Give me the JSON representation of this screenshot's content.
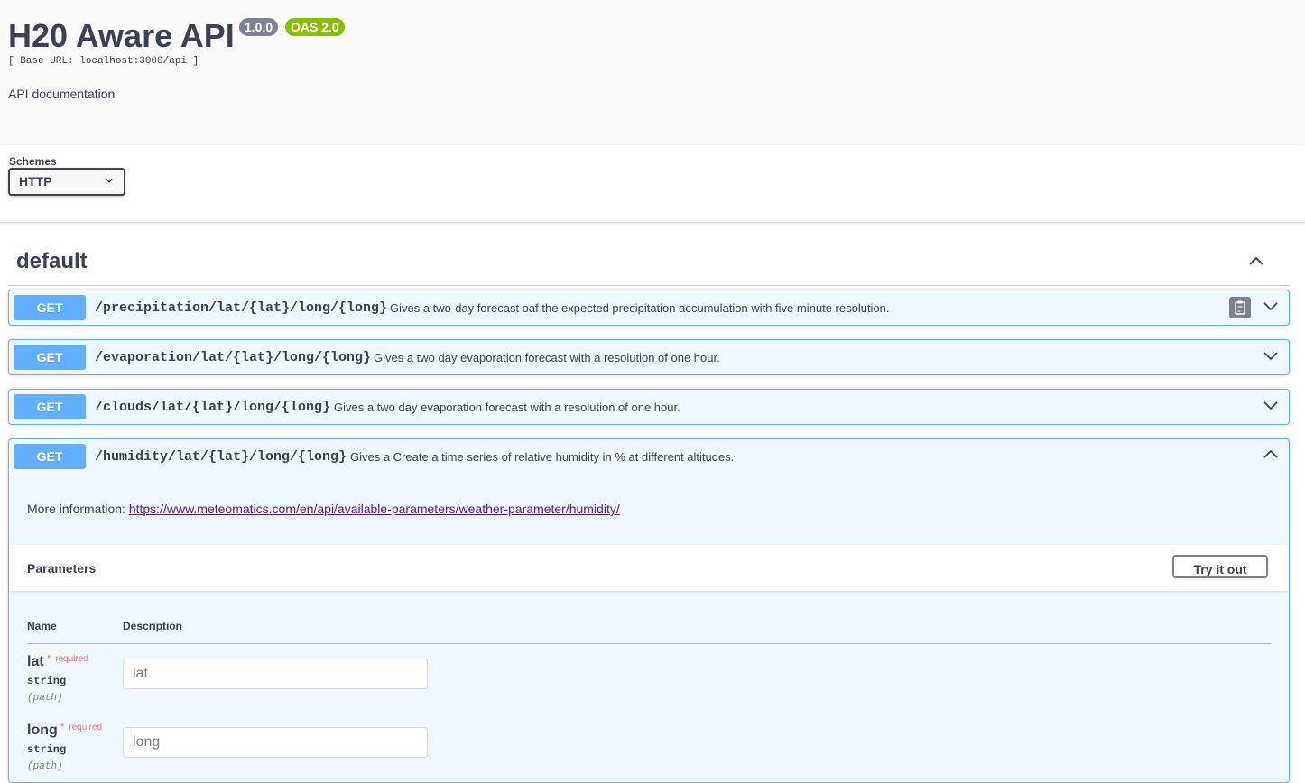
{
  "info": {
    "title": "H20 Aware API",
    "version": "1.0.0",
    "oas": "OAS 2.0",
    "base_url": "[ Base URL: localhost:3000/api ]",
    "description": "API documentation"
  },
  "schemes": {
    "label": "Schemes",
    "selected": "HTTP"
  },
  "section": {
    "title": "default",
    "icon": "chevron-up-icon"
  },
  "operations": [
    {
      "method": "GET",
      "path": "/precipitation/lat/{lat}/long/{long}",
      "description": "Gives a two-day forecast oaf the expected precipitation accumulation with five minute resolution.",
      "expanded": false
    },
    {
      "method": "GET",
      "path": "/evaporation/lat/{lat}/long/{long}",
      "description": "Gives a two day evaporation forecast with a resolution of one hour.",
      "expanded": false
    },
    {
      "method": "GET",
      "path": "/clouds/lat/{lat}/long/{long}",
      "description": "Gives a two day evaporation forecast with a resolution of one hour.",
      "expanded": false
    },
    {
      "method": "GET",
      "path": "/humidity/lat/{lat}/long/{long}",
      "description": "Gives a Create a time series of relative humidity in % at different altitudes.",
      "expanded": true,
      "more_info_label": "More information:",
      "more_info_link": "https://www.meteomatics.com/en/api/available-parameters/weather-parameter/humidity/",
      "parameters_title": "Parameters",
      "try_it_out": "Try it out",
      "table_headers": {
        "name": "Name",
        "description": "Description"
      },
      "params": [
        {
          "name": "lat",
          "required_star": "*",
          "required": "required",
          "type": "string",
          "in": "(path)",
          "placeholder": "lat"
        },
        {
          "name": "long",
          "required_star": "*",
          "required": "required",
          "type": "string",
          "in": "(path)",
          "placeholder": "long"
        }
      ]
    }
  ],
  "colors": {
    "get": "#61affe",
    "badge_version": "#7d8492",
    "badge_oas": "#89bf04",
    "required": "#ff6f6f"
  }
}
